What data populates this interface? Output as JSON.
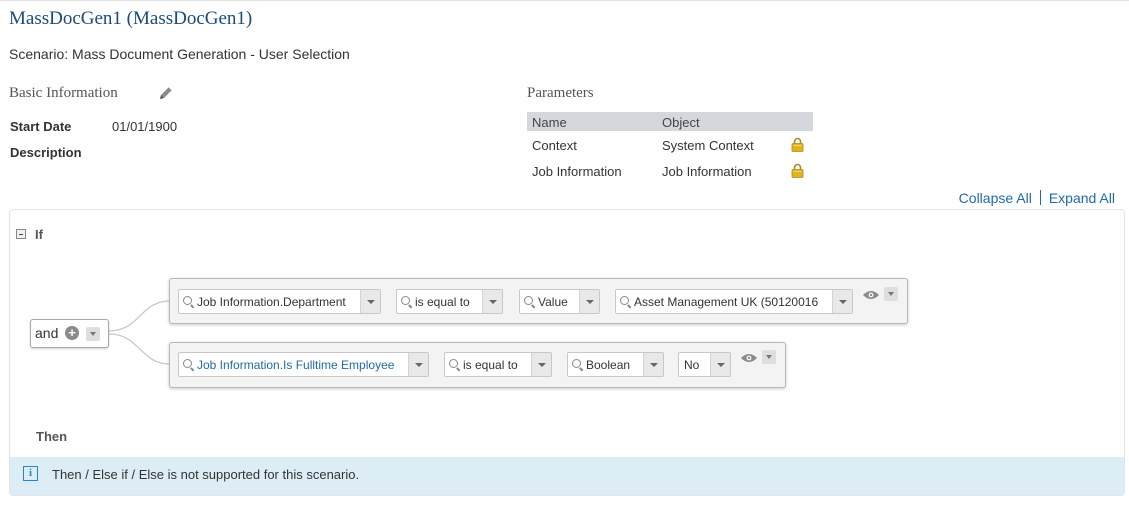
{
  "header": {
    "title": "MassDocGen1 (MassDocGen1)",
    "scenario": "Scenario: Mass Document Generation - User Selection"
  },
  "basic_info": {
    "heading": "Basic Information",
    "edit_icon": "pencil-icon",
    "start_date_label": "Start Date",
    "start_date_value": "01/01/1900",
    "description_label": "Description"
  },
  "parameters": {
    "heading": "Parameters",
    "columns": [
      "Name",
      "Object"
    ],
    "rows": [
      {
        "name": "Context",
        "object": "System Context",
        "icon": "lock-icon"
      },
      {
        "name": "Job Information",
        "object": "Job Information",
        "icon": "lock-icon"
      }
    ]
  },
  "toolbar": {
    "collapse_all": "Collapse All",
    "expand_all": "Expand All"
  },
  "rule": {
    "if_label": "If",
    "operator": "and",
    "conditions": [
      {
        "field": "Job Information.Department",
        "comparator": "is equal to",
        "value_type": "Value",
        "value": "Asset Management UK (50120016"
      },
      {
        "field": "Job Information.Is Fulltime Employee",
        "comparator": "is equal to",
        "value_type": "Boolean",
        "value": "No"
      }
    ],
    "then_label": "Then",
    "info_message": "Then / Else if / Else is not supported for this scenario.",
    "info_icon_glyph": "i",
    "plus_glyph": "+"
  },
  "colors": {
    "title": "#1b4b7a",
    "link": "#1f6aa8",
    "info_bg": "#dcedf6",
    "table_header_bg": "#d4d8dd",
    "lock": "#e0b41c"
  }
}
